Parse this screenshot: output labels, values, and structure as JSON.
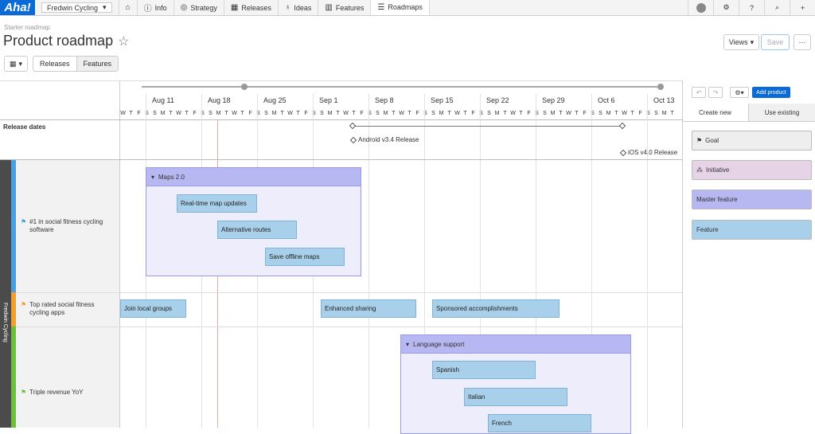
{
  "nav": {
    "logo": "Aha!",
    "product": "Fredwin Cycling",
    "items": [
      {
        "icon": "home-icon",
        "label": ""
      },
      {
        "icon": "info-icon",
        "label": "Info"
      },
      {
        "icon": "strategy-icon",
        "label": "Strategy"
      },
      {
        "icon": "calendar-icon",
        "label": "Releases"
      },
      {
        "icon": "lightbulb-icon",
        "label": "Ideas"
      },
      {
        "icon": "grid-icon",
        "label": "Features"
      },
      {
        "icon": "roadmap-icon",
        "label": "Roadmaps"
      }
    ],
    "active": "Roadmaps"
  },
  "page": {
    "breadcrumb": "Starter roadmap",
    "title": "Product roadmap",
    "views_label": "Views",
    "save_label": "Save",
    "more_label": "···",
    "toggle": [
      "Releases",
      "Features"
    ]
  },
  "timeline": {
    "weeks": [
      "Aug 11",
      "Aug 18",
      "Aug 25",
      "Sep 1",
      "Sep 8",
      "Sep 15",
      "Sep 22",
      "Sep 29",
      "Oct 6",
      "Oct 13"
    ],
    "day_letters": "WTFSSMTWTFSSMTWTFSSMTWTFSSMTWTFSSMTWTFSSMTWTFSSMTWTFSSMTWTFSSMTWTFSSMTWTFSSMTWTFSSMTWTFSSMTWTFSSMTWTFSSMTWTFSSMTWTFSSMTWTFSSMTWTFSSMTWTFSSMTWTFSSMTWTFSSMTWTFSSMTWTFSSMTWTFSSMTWTFSSMTWTFSSMTWTFSSMTWTFSSMTWTFSSMTWTFSSMTWTFSSMTWTFSSMTWTFSSMTWTFSSMTWTFS"
  },
  "release_dates": {
    "label": "Release dates",
    "releases": [
      "Android v3.4 Release",
      "iOS v4.0 Release"
    ]
  },
  "product_label": "Fredwin Cycling",
  "goals": [
    {
      "label": "#1 in social fitness cycling software",
      "color": "#4a9fe0"
    },
    {
      "label": "Top rated social fitness cycling apps",
      "color": "#f0a030"
    },
    {
      "label": "Triple revenue YoY",
      "color": "#6cbf3c"
    }
  ],
  "masters": [
    {
      "label": "Maps 2.0"
    },
    {
      "label": "Language support"
    }
  ],
  "features": [
    "Real-time map updates",
    "Alternative routes",
    "Save offline maps",
    "Join local groups",
    "Enhanced sharing",
    "Sponsored accomplishments",
    "Spanish",
    "Italian",
    "French"
  ],
  "panel": {
    "add_product": "Add product",
    "tabs": [
      "Create new",
      "Use existing"
    ],
    "cards": [
      {
        "label": "Goal",
        "icon": "flag-icon",
        "color": "#eeeeee"
      },
      {
        "label": "Initiative",
        "icon": "initiative-icon",
        "color": "#e6d3e6"
      },
      {
        "label": "Master feature",
        "icon": "",
        "color": "#b7b7f1"
      },
      {
        "label": "Feature",
        "icon": "",
        "color": "#a9d0ea"
      }
    ]
  }
}
